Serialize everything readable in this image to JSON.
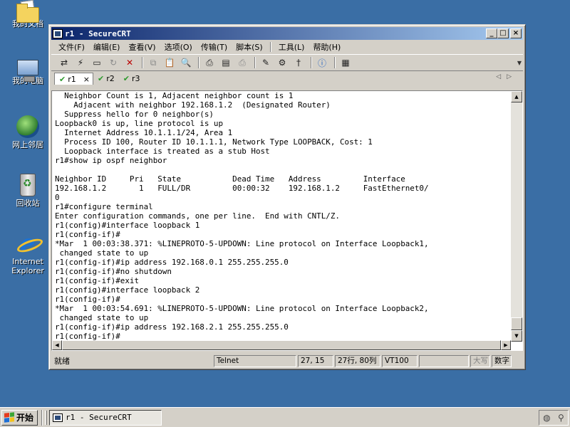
{
  "desktop": {
    "icons": [
      {
        "label": "我的文档",
        "icon": "folder-documents-icon"
      },
      {
        "label": "我的电脑",
        "icon": "computer-icon"
      },
      {
        "label": "网上邻居",
        "icon": "network-icon"
      },
      {
        "label": "回收站",
        "icon": "recycle-bin-icon"
      },
      {
        "label": "Internet Explorer",
        "icon": "internet-explorer-icon"
      }
    ]
  },
  "window": {
    "title": "r1 - SecureCRT",
    "controls": {
      "minimize": "_",
      "maximize": "□",
      "close": "×"
    }
  },
  "menu": [
    "文件(F)",
    "编辑(E)",
    "查看(V)",
    "选项(O)",
    "传输(T)",
    "脚本(S)",
    "工具(L)",
    "帮助(H)"
  ],
  "toolbar": {
    "icons": [
      "connect-icon",
      "quick-connect-icon",
      "connect-tab-icon",
      "reconnect-icon",
      "disconnect-icon",
      "copy-icon",
      "paste-icon",
      "find-icon",
      "print-icon",
      "print-setup-icon",
      "print-selection-icon",
      "session-options-icon",
      "global-options-icon",
      "keymap-icon",
      "help-icon",
      "log-icon"
    ]
  },
  "tabs": [
    {
      "label": "r1",
      "close": "×",
      "active": true
    },
    {
      "label": "r2",
      "active": false
    },
    {
      "label": "r3",
      "active": false
    }
  ],
  "terminal": {
    "lines": [
      "  Neighbor Count is 1, Adjacent neighbor count is 1",
      "    Adjacent with neighbor 192.168.1.2  (Designated Router)",
      "  Suppress hello for 0 neighbor(s)",
      "Loopback0 is up, line protocol is up",
      "  Internet Address 10.1.1.1/24, Area 1",
      "  Process ID 100, Router ID 10.1.1.1, Network Type LOOPBACK, Cost: 1",
      "  Loopback interface is treated as a stub Host",
      "r1#show ip ospf neighbor",
      "",
      "Neighbor ID     Pri   State           Dead Time   Address         Interface",
      "192.168.1.2       1   FULL/DR         00:00:32    192.168.1.2     FastEthernet0/",
      "0",
      "r1#configure terminal",
      "Enter configuration commands, one per line.  End with CNTL/Z.",
      "r1(config)#interface loopback 1",
      "r1(config-if)#",
      "*Mar  1 00:03:38.371: %LINEPROTO-5-UPDOWN: Line protocol on Interface Loopback1,",
      " changed state to up",
      "r1(config-if)#ip address 192.168.0.1 255.255.255.0",
      "r1(config-if)#no shutdown",
      "r1(config-if)#exit",
      "r1(config)#interface loopback 2",
      "r1(config-if)#",
      "*Mar  1 00:03:54.691: %LINEPROTO-5-UPDOWN: Line protocol on Interface Loopback2,",
      " changed state to up",
      "r1(config-if)#ip address 192.168.2.1 255.255.255.0",
      "r1(config-if)#"
    ]
  },
  "status": {
    "ready": "就绪",
    "protocol": "Telnet",
    "cursor": "27, 15",
    "size": "27行, 80列",
    "emulation": "VT100",
    "blank": "",
    "caps": "大写",
    "num": "数字"
  },
  "taskbar": {
    "start": "开始",
    "task": "r1 - SecureCRT"
  }
}
